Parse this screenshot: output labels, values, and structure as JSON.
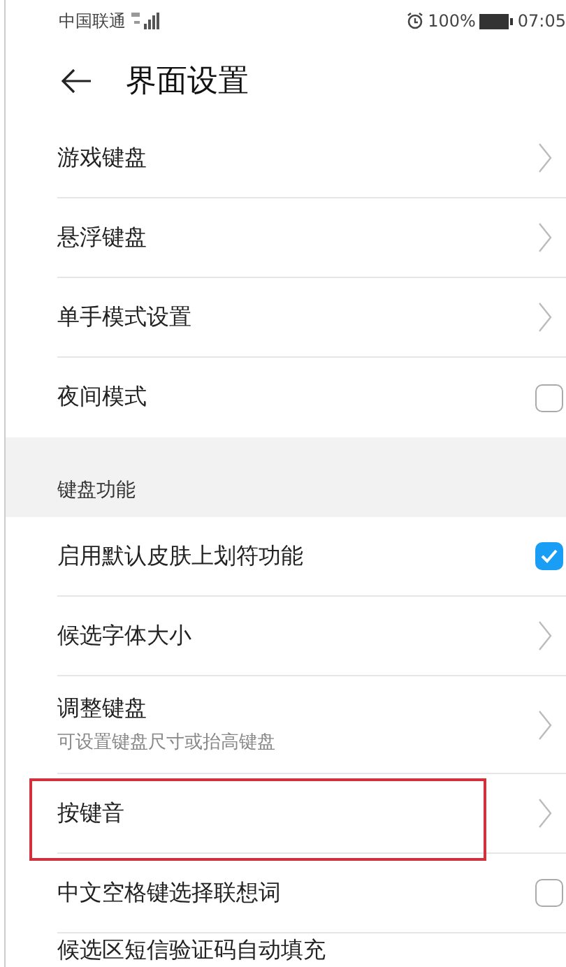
{
  "status_bar": {
    "carrier": "中国联通",
    "battery": "100%",
    "time": "07:05"
  },
  "header": {
    "title": "界面设置"
  },
  "groups": [
    {
      "items": [
        {
          "kind": "chevron",
          "label": "游戏键盘",
          "highlighted": false
        },
        {
          "kind": "chevron",
          "label": "悬浮键盘",
          "highlighted": false
        },
        {
          "kind": "chevron",
          "label": "单手模式设置",
          "highlighted": false
        },
        {
          "kind": "checkbox",
          "label": "夜间模式",
          "checked": false,
          "highlighted": false
        }
      ]
    },
    {
      "title": "键盘功能",
      "items": [
        {
          "kind": "checkbox",
          "label": "启用默认皮肤上划符功能",
          "checked": true,
          "highlighted": false
        },
        {
          "kind": "chevron",
          "label": "候选字体大小",
          "highlighted": false
        },
        {
          "kind": "chevron",
          "label": "调整键盘",
          "subtitle": "可设置键盘尺寸或抬高键盘",
          "highlighted": false
        },
        {
          "kind": "chevron",
          "label": "按键音",
          "highlighted": true
        },
        {
          "kind": "checkbox",
          "label": "中文空格键选择联想词",
          "checked": false,
          "highlighted": false
        },
        {
          "kind": "partial",
          "label": "候选区短信验证码自动填充",
          "highlighted": false
        }
      ]
    }
  ]
}
